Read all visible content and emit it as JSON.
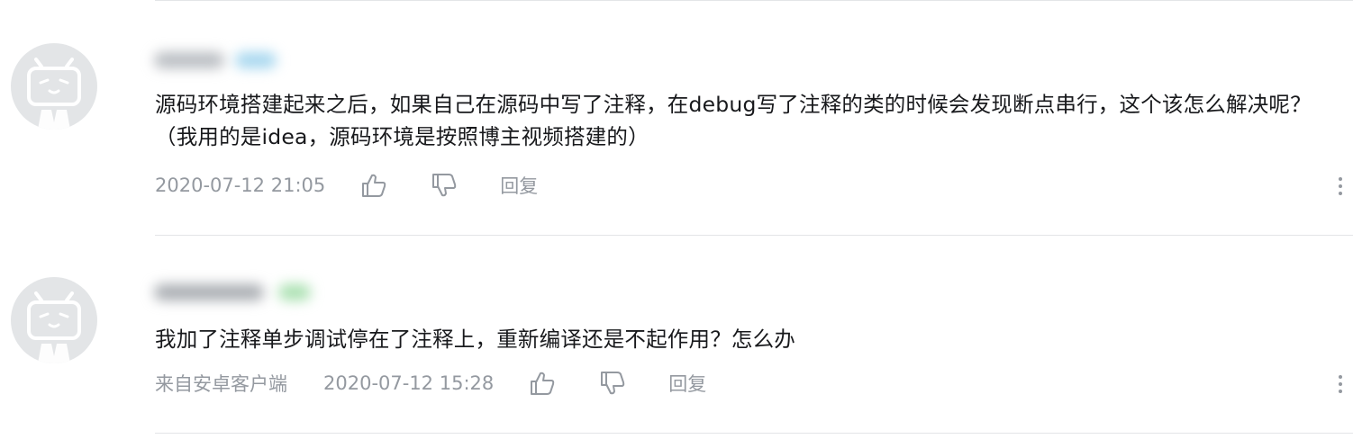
{
  "comments": [
    {
      "username": "",
      "badge_color": "#a7d7ef",
      "content": "源码环境搭建起来之后，如果自己在源码中写了注释，在debug写了注释的类的时候会发现断点串行，这个该怎么解决呢？（我用的是idea，源码环境是按照博主视频搭建的）",
      "source": "",
      "time": "2020-07-12 21:05",
      "like_icon": "thumbs-up-icon",
      "dislike_icon": "thumbs-down-icon",
      "reply_label": "回复",
      "more_icon": "more-vertical-icon"
    },
    {
      "username": "",
      "badge_color": "#a9e0b0",
      "content": "我加了注释单步调试停在了注释上，重新编译还是不起作用？怎么办",
      "source": "来自安卓客户端",
      "time": "2020-07-12 15:28",
      "like_icon": "thumbs-up-icon",
      "dislike_icon": "thumbs-down-icon",
      "reply_label": "回复",
      "more_icon": "more-vertical-icon"
    }
  ],
  "colors": {
    "text": "#18191c",
    "meta": "#9499a0",
    "divider": "#e3e5e7",
    "avatar_bg": "#e3e5e7",
    "avatar_fg": "#ffffff"
  }
}
